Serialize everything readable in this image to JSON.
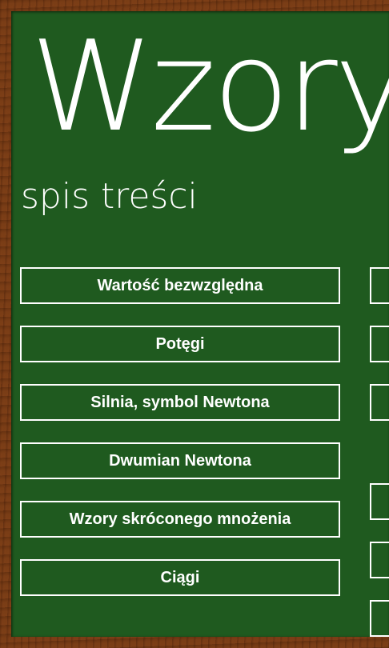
{
  "app": {
    "title": "Wzory"
  },
  "section": {
    "title": "spis treści"
  },
  "topics": [
    {
      "label": "Wartość bezwzględna"
    },
    {
      "label": "Potęgi"
    },
    {
      "label": "Silnia, symbol Newtona"
    },
    {
      "label": "Dwumian Newtona"
    },
    {
      "label": "Wzory skróconego mnożenia"
    },
    {
      "label": "Ciągi"
    }
  ],
  "colors": {
    "board": "#1f5a1f",
    "frame": "#7a3d16",
    "foreground": "#ffffff"
  }
}
